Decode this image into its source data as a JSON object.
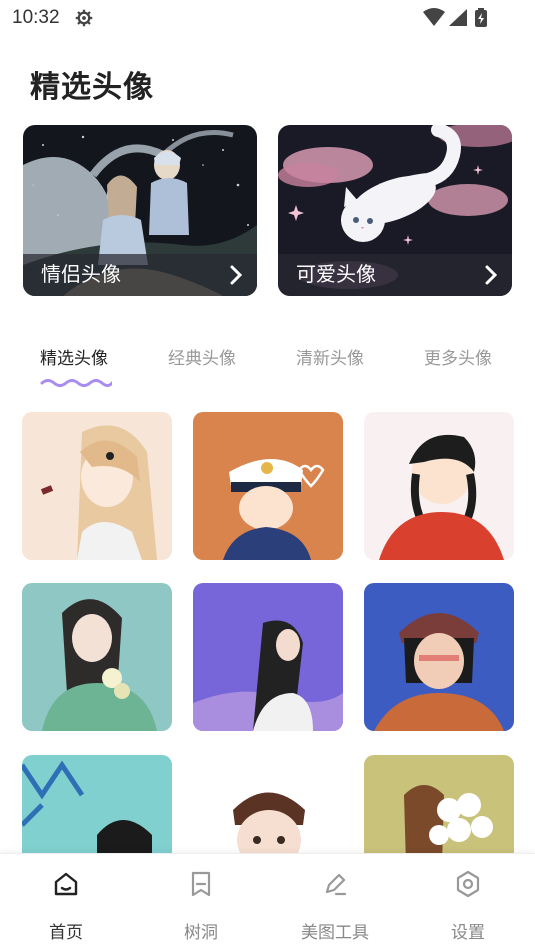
{
  "status_bar": {
    "time": "10:32"
  },
  "page_title": "精选头像",
  "cards": [
    {
      "label": "情侣头像"
    },
    {
      "label": "可爱头像"
    }
  ],
  "tabs": [
    {
      "label": "精选头像",
      "active": true
    },
    {
      "label": "经典头像",
      "active": false
    },
    {
      "label": "清新头像",
      "active": false
    },
    {
      "label": "更多头像",
      "active": false
    }
  ],
  "bottom_nav": [
    {
      "label": "首页",
      "icon": "home-icon",
      "active": true
    },
    {
      "label": "树洞",
      "icon": "bookmark-icon",
      "active": false
    },
    {
      "label": "美图工具",
      "icon": "pen-icon",
      "active": false
    },
    {
      "label": "设置",
      "icon": "settings-hexagon-icon",
      "active": false
    }
  ],
  "colors": {
    "accent_underline": "#a98cf0",
    "card_overlay": "#2a2a32"
  }
}
